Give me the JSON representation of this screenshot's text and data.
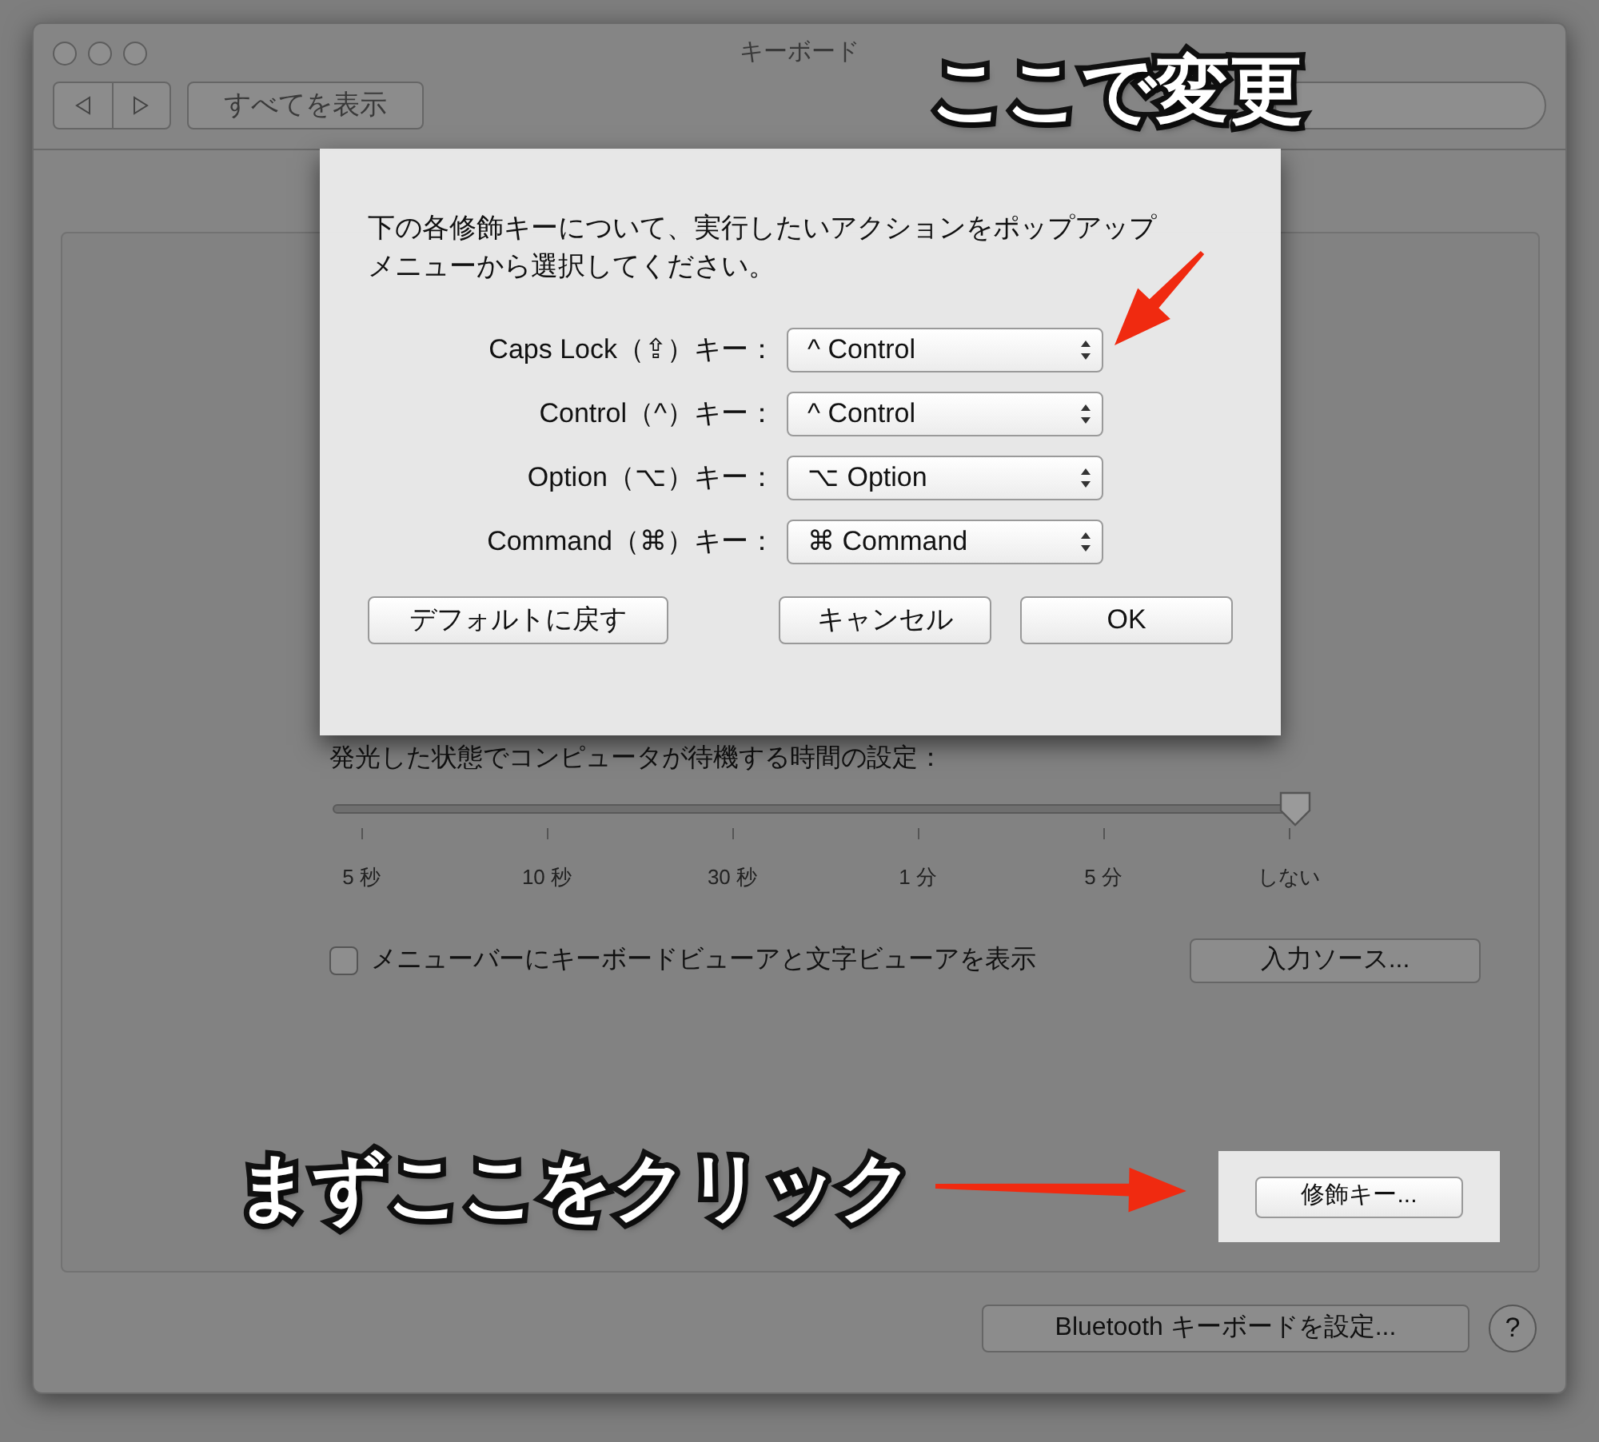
{
  "window": {
    "title": "キーボード",
    "show_all": "すべてを表示"
  },
  "dialog": {
    "message": "下の各修飾キーについて、実行したいアクションをポップアップメニューから選択してください。",
    "rows": [
      {
        "label": "Caps Lock（⇪）キー：",
        "value": "^ Control"
      },
      {
        "label": "Control（^）キー：",
        "value": "^ Control"
      },
      {
        "label": "Option（⌥）キー：",
        "value": "⌥ Option"
      },
      {
        "label": "Command（⌘）キー：",
        "value": "⌘ Command"
      }
    ],
    "buttons": [
      {
        "label": "デフォルトに戻す",
        "kind": "restore"
      },
      {
        "label": "キャンセル",
        "kind": "cancel"
      },
      {
        "label": "OK",
        "kind": "ok"
      }
    ]
  },
  "backlight": {
    "label": "発光した状態でコンピュータが待機する時間の設定：",
    "level": 1,
    "ticks": [
      "5 秒",
      "10 秒",
      "30 秒",
      "1 分",
      "5 分",
      "しない"
    ]
  },
  "viewer_checkbox": {
    "label": "メニューバーにキーボードビューアと文字ビューアを表示",
    "checked": false
  },
  "input_sources_button": "入力ソース...",
  "modifier_button": "修飾キー...",
  "bluetooth_button": "Bluetooth キーボードを設定...",
  "help_button": "?",
  "annotations": [
    {
      "text": "ここで変更",
      "kind": "top"
    },
    {
      "text": "まずここをクリック",
      "kind": "bottom"
    }
  ]
}
